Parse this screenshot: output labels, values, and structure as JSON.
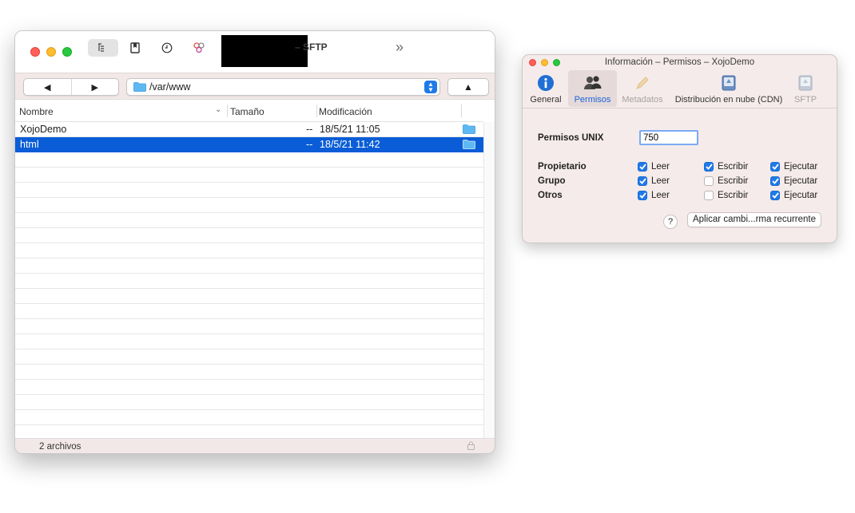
{
  "main_window": {
    "title": "– SFTP",
    "nav": {
      "back": "◀",
      "forward": "▶",
      "path": "/var/www",
      "up": "▲"
    },
    "columns": {
      "name": "Nombre",
      "size": "Tamaño",
      "modified": "Modificación"
    },
    "rows": [
      {
        "name": "XojoDemo",
        "size": "--",
        "modified": "18/5/21 11:05",
        "selected": false
      },
      {
        "name": "html",
        "size": "--",
        "modified": "18/5/21 11:42",
        "selected": true
      }
    ],
    "status": "2 archivos"
  },
  "info_window": {
    "title": "Información – Permisos – XojoDemo",
    "tabs": [
      "General",
      "Permisos",
      "Metadatos",
      "Distribución en nube (CDN)",
      "SFTP"
    ],
    "unix_label": "Permisos UNIX",
    "unix_value": "750",
    "groups": [
      "Propietario",
      "Grupo",
      "Otros"
    ],
    "perms": [
      "Leer",
      "Escribir",
      "Ejecutar"
    ],
    "matrix": [
      [
        true,
        true,
        true
      ],
      [
        true,
        false,
        true
      ],
      [
        true,
        false,
        true
      ]
    ],
    "help": "?",
    "apply": "Aplicar cambi...rma recurrente"
  },
  "colors": {
    "accent": "#1f7ae8",
    "selection": "#0a5dd6"
  }
}
